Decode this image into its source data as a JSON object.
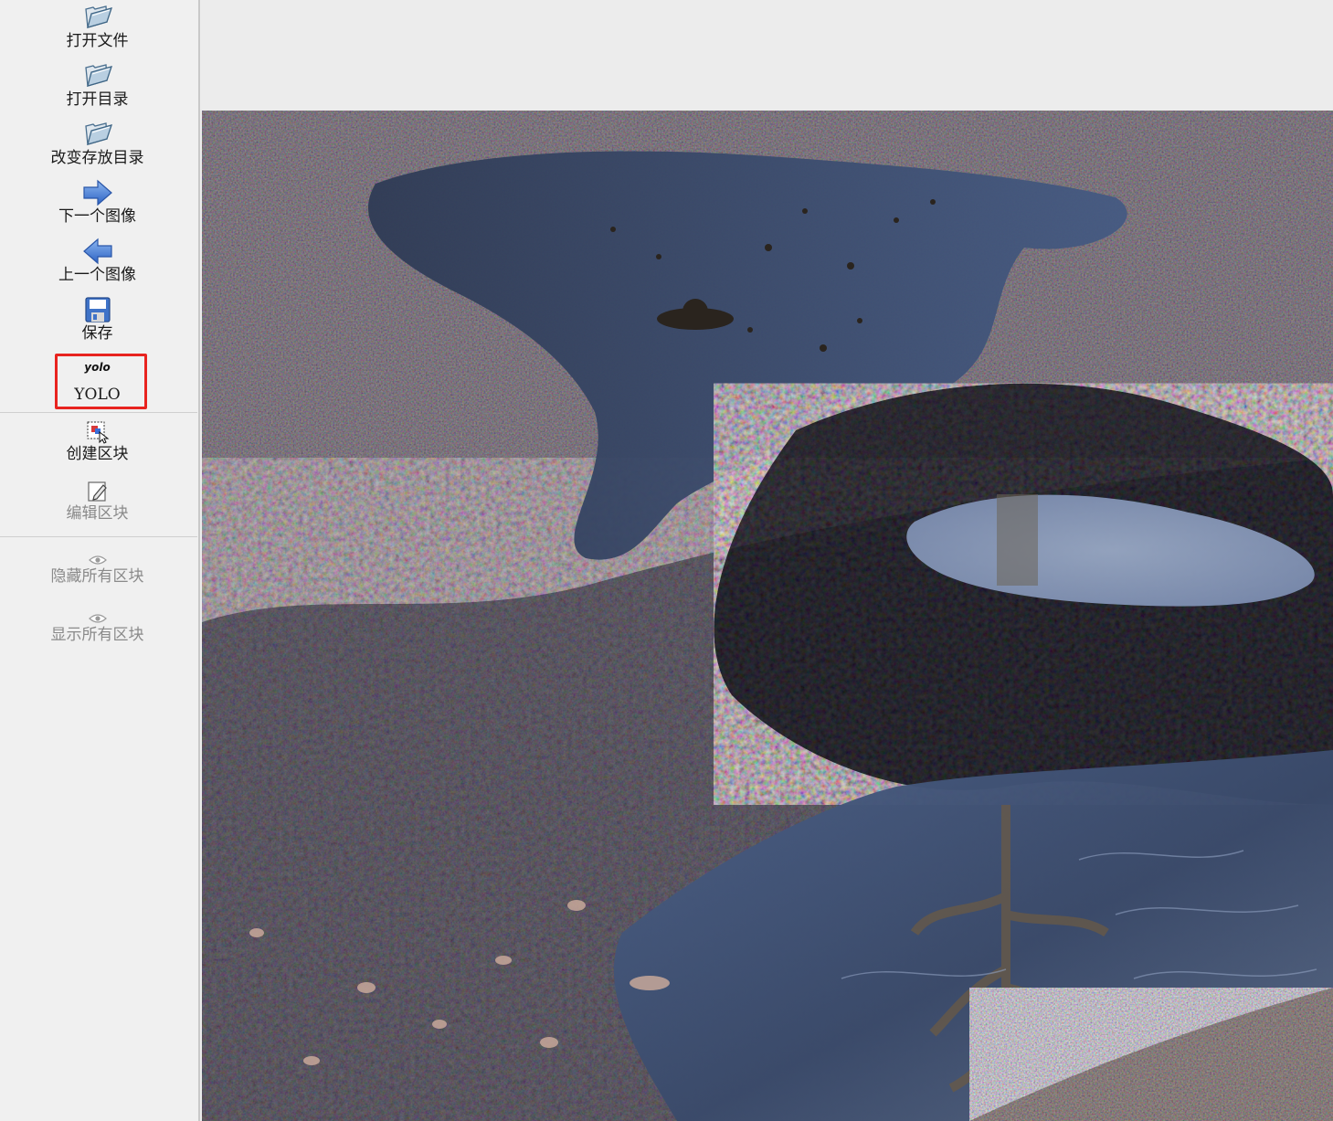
{
  "toolbar": {
    "open_file": "打开文件",
    "open_dir": "打开目录",
    "change_save_dir": "改变存放目录",
    "next_image": "下一个图像",
    "prev_image": "上一个图像",
    "save": "保存",
    "yolo_icon_text": "yolo",
    "yolo": "YOLO",
    "create_box": "创建区块",
    "edit_box": "编辑区块",
    "hide_all": "隐藏所有区块",
    "show_all": "显示所有区块"
  },
  "icons": {
    "open_file": "folder-open-icon",
    "open_dir": "folder-open-icon",
    "change_save_dir": "folder-open-icon",
    "next_image": "arrow-right-icon",
    "prev_image": "arrow-left-icon",
    "save": "floppy-disk-icon",
    "create_box": "create-box-icon",
    "edit_box": "edit-icon",
    "hide_all": "eye-icon",
    "show_all": "eye-icon"
  },
  "colors": {
    "highlight_box": "#e8231f",
    "arrow_blue": "#3d7ad6",
    "toolbar_bg": "#f0f0f0"
  }
}
